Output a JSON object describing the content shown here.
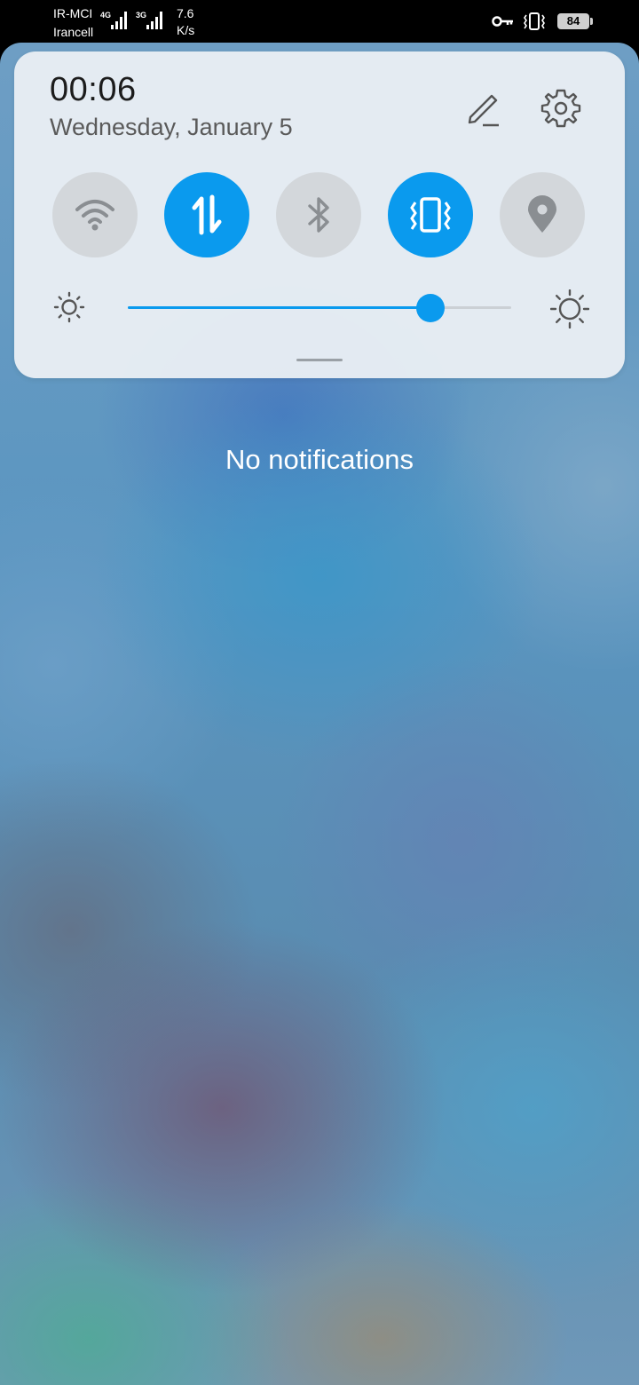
{
  "status_bar": {
    "carrier_1": "IR-MCI",
    "carrier_2": "Irancell",
    "sim1_network": "4G",
    "sim2_network": "3G",
    "speed_value": "7.6",
    "speed_unit": "K/s",
    "battery_level": "84",
    "icons": [
      "key-icon",
      "vibrate-icon",
      "battery-icon"
    ]
  },
  "panel": {
    "time": "00:06",
    "date": "Wednesday, January 5",
    "toggles": [
      {
        "name": "wifi",
        "icon": "wifi-icon",
        "active": false
      },
      {
        "name": "mobile-data",
        "icon": "mobile-data-icon",
        "active": true
      },
      {
        "name": "bluetooth",
        "icon": "bluetooth-icon",
        "active": false
      },
      {
        "name": "vibrate",
        "icon": "vibrate-icon",
        "active": true
      },
      {
        "name": "location",
        "icon": "location-icon",
        "active": false
      }
    ],
    "brightness_level": 0.79,
    "accent_color": "#0a9aee",
    "inactive_color": "#d3d7db"
  },
  "notifications": {
    "empty_text": "No notifications"
  }
}
